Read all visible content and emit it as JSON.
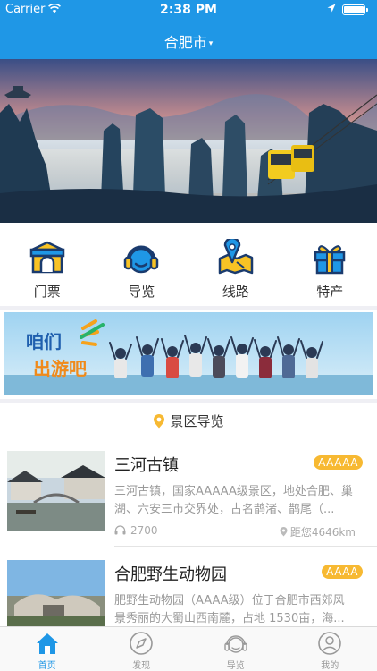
{
  "status_bar": {
    "carrier": "Carrier",
    "time": "2:38 PM"
  },
  "nav": {
    "title": "合肥市",
    "caret": "▾"
  },
  "quick_entries": [
    {
      "label": "门票",
      "icon": "ticket-gate-icon"
    },
    {
      "label": "导览",
      "icon": "headphones-guide-icon"
    },
    {
      "label": "线路",
      "icon": "route-map-icon"
    },
    {
      "label": "特产",
      "icon": "gift-icon"
    }
  ],
  "promo": {
    "line1": "咱们",
    "line2": "出游吧"
  },
  "section": {
    "title": "景区导览"
  },
  "spots": [
    {
      "name": "三河古镇",
      "badge": "AAAAA",
      "desc": "三河古镇，国家AAAAA级景区，地处合肥、巢湖、六安三市交界处，古名鹊渚、鹊尾（...",
      "listens": "2700",
      "distance": "距您4646km"
    },
    {
      "name": "合肥野生动物园",
      "badge": "AAAA",
      "desc": "肥野生动物园（AAAA级）位于合肥市西郊风景秀丽的大蜀山西南麓，占地 1530亩，海...",
      "listens": "",
      "distance": ""
    }
  ],
  "tabbar": [
    {
      "label": "首页",
      "icon": "home-icon",
      "active": true
    },
    {
      "label": "发现",
      "icon": "compass-icon",
      "active": false
    },
    {
      "label": "导览",
      "icon": "headphones-icon",
      "active": false
    },
    {
      "label": "我的",
      "icon": "user-icon",
      "active": false
    }
  ],
  "colors": {
    "primary": "#1f97e6",
    "badge": "#f7b932",
    "icon_yellow": "#f8c325"
  }
}
